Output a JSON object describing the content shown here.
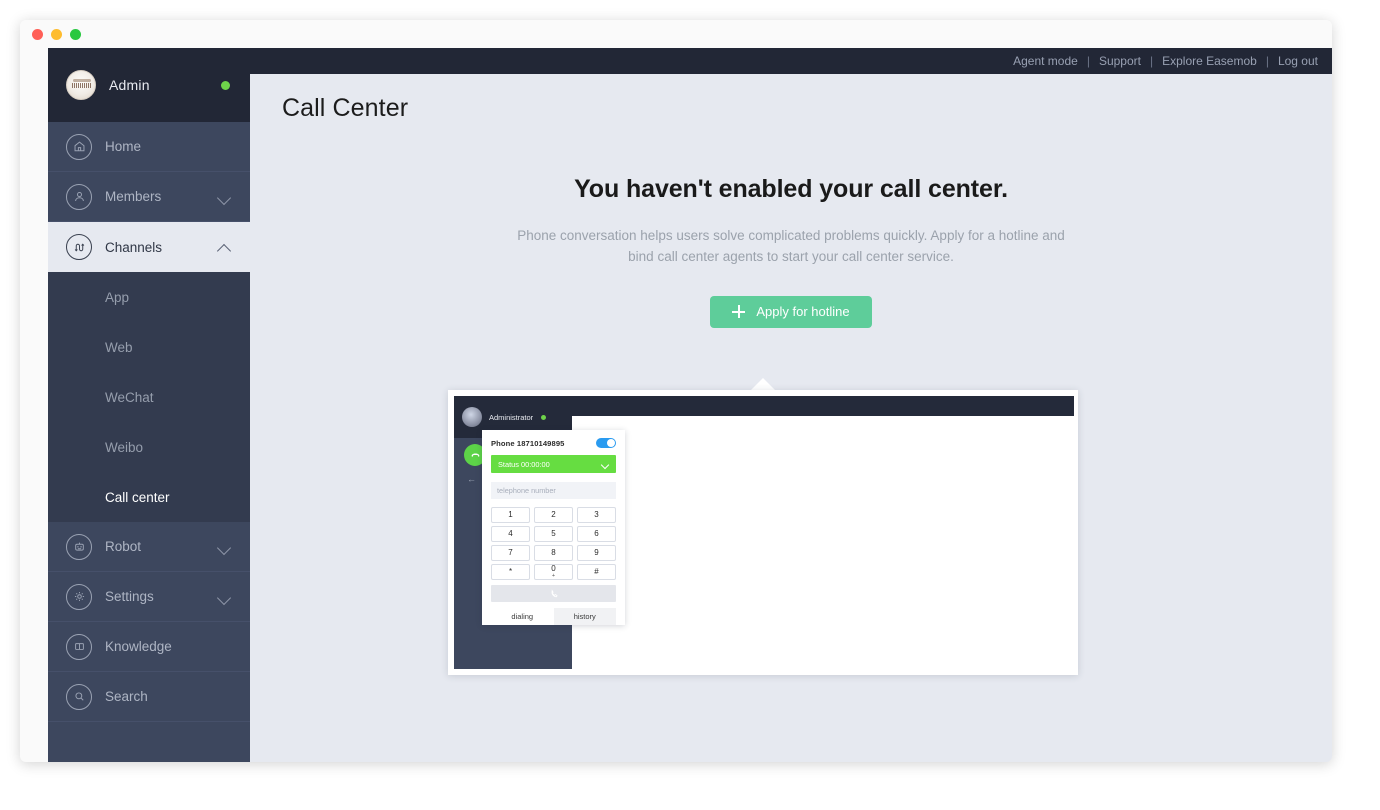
{
  "window": {
    "traffic_lights": [
      "close",
      "minimize",
      "maximize"
    ]
  },
  "topbar": {
    "links": [
      "Agent mode",
      "Support",
      "Explore Easemob",
      "Log out"
    ],
    "separator": "|"
  },
  "sidebar": {
    "profile": {
      "name": "Admin",
      "status": "online",
      "status_color": "#6ed34a"
    },
    "items": [
      {
        "label": "Home",
        "icon": "home-icon",
        "expandable": false,
        "active": false
      },
      {
        "label": "Members",
        "icon": "members-icon",
        "expandable": true,
        "expanded": false,
        "active": false
      },
      {
        "label": "Channels",
        "icon": "channels-icon",
        "expandable": true,
        "expanded": true,
        "active": true
      },
      {
        "label": "Robot",
        "icon": "robot-icon",
        "expandable": true,
        "expanded": false,
        "active": false
      },
      {
        "label": "Settings",
        "icon": "gear-icon",
        "expandable": true,
        "expanded": false,
        "active": false
      },
      {
        "label": "Knowledge",
        "icon": "book-icon",
        "expandable": false,
        "active": false
      },
      {
        "label": "Search",
        "icon": "search-icon",
        "expandable": false,
        "active": false
      }
    ],
    "submenu": [
      {
        "label": "App",
        "active": false
      },
      {
        "label": "Web",
        "active": false
      },
      {
        "label": "WeChat",
        "active": false
      },
      {
        "label": "Weibo",
        "active": false
      },
      {
        "label": "Call center",
        "active": true
      }
    ]
  },
  "main": {
    "page_title": "Call Center",
    "empty_state": {
      "heading": "You haven't enabled your call center.",
      "description": "Phone conversation helps users solve complicated problems quickly. Apply for a hotline and bind call center agents to start your call center service.",
      "button_label": "Apply for hotline",
      "button_color": "#5ecd9a",
      "button_icon": "plus-icon"
    }
  },
  "screenshot_card": {
    "admin_name": "Administrator",
    "admin_status_color": "#6ed34a",
    "dialer": {
      "phone_label": "Phone 18710149895",
      "toggle_on": true,
      "toggle_color": "#2a9bf0",
      "status_label": "Status 00:00:00",
      "status_color": "#66dd41",
      "input_placeholder": "telephone number",
      "keys": [
        {
          "main": "1",
          "sub": ""
        },
        {
          "main": "2",
          "sub": ""
        },
        {
          "main": "3",
          "sub": ""
        },
        {
          "main": "4",
          "sub": ""
        },
        {
          "main": "5",
          "sub": ""
        },
        {
          "main": "6",
          "sub": ""
        },
        {
          "main": "7",
          "sub": ""
        },
        {
          "main": "8",
          "sub": ""
        },
        {
          "main": "9",
          "sub": ""
        },
        {
          "main": "*",
          "sub": ""
        },
        {
          "main": "0",
          "sub": "+"
        },
        {
          "main": "#",
          "sub": ""
        }
      ],
      "call_button_icon": "phone-icon",
      "tabs": [
        {
          "label": "dialing",
          "active": true
        },
        {
          "label": "history",
          "active": false
        }
      ]
    }
  }
}
